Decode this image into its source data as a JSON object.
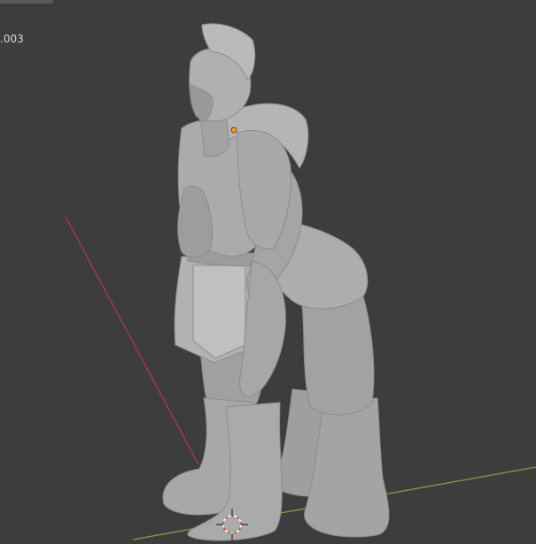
{
  "viewport": {
    "object_name_overlay": ".003",
    "colors": {
      "background": "#3d3d3d",
      "x_axis": "#b03a48",
      "y_axis": "#7fa046",
      "model": "#a8a8a8",
      "origin_dot": "#f7a21b",
      "cursor_red": "#d8383a"
    },
    "icons": {
      "cursor": "3d-cursor-icon",
      "origin": "object-origin-icon"
    }
  }
}
